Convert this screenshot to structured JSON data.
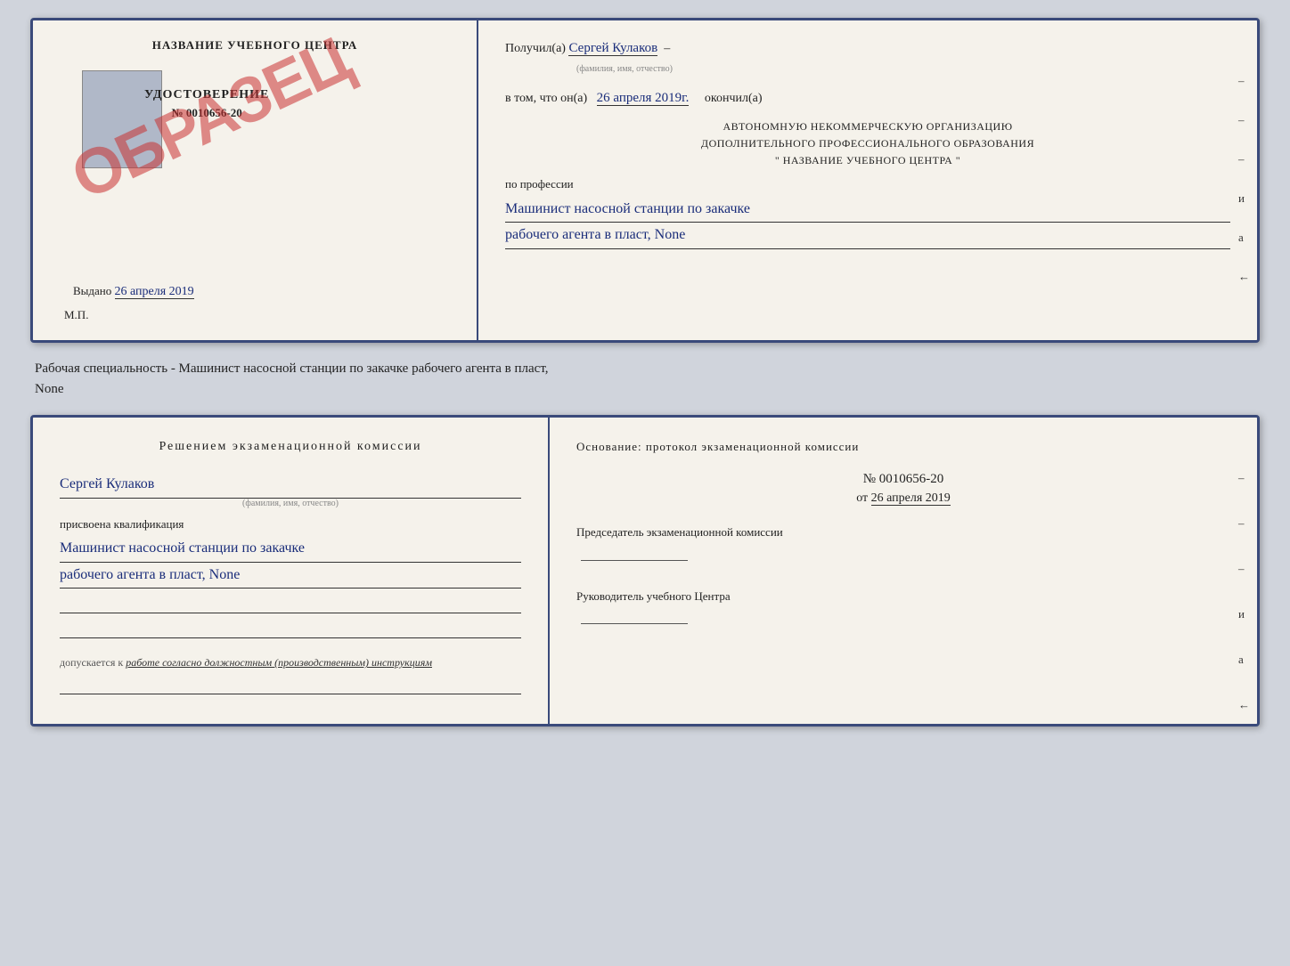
{
  "top_doc": {
    "left": {
      "title": "НАЗВАНИЕ УЧЕБНОГО ЦЕНТРА",
      "cert_label": "УДОСТОВЕРЕНИЕ",
      "cert_number": "№ 0010656-20",
      "stamp": "ОБРАЗЕЦ",
      "vydano_label": "Выдано",
      "vydano_date": "26 апреля 2019",
      "mp_label": "М.П."
    },
    "right": {
      "poluchil_label": "Получил(а)",
      "poluchil_name": "Сергей Кулаков",
      "fio_hint": "(фамилия, имя, отчество)",
      "vtom_label": "в том, что он(а)",
      "vtom_date": "26 апреля 2019г.",
      "okonchil_label": "окончил(а)",
      "center_line1": "АВТОНОМНУЮ НЕКОММЕРЧЕСКУЮ ОРГАНИЗАЦИЮ",
      "center_line2": "ДОПОЛНИТЕЛЬНОГО ПРОФЕССИОНАЛЬНОГО ОБРАЗОВАНИЯ",
      "center_line3": "\"  НАЗВАНИЕ УЧЕБНОГО ЦЕНТРА  \"",
      "po_professii": "по профессии",
      "profession_line1": "Машинист насосной станции по закачке",
      "profession_line2": "рабочего агента в пласт, None",
      "dashes": [
        "-",
        "-",
        "-",
        "и",
        "а",
        "←"
      ]
    }
  },
  "middle_text": {
    "line1": "Рабочая специальность - Машинист насосной станции по закачке рабочего агента в пласт,",
    "line2": "None"
  },
  "bottom_doc": {
    "left": {
      "title": "Решением  экзаменационной  комиссии",
      "name": "Сергей Кулаков",
      "fio_hint": "(фамилия, имя, отчество)",
      "prisvoena_label": "присвоена квалификация",
      "profession_line1": "Машинист насосной станции по закачке",
      "profession_line2": "рабочего агента в пласт, None",
      "dopuskaetsya_label": "допускается к",
      "dopuskaetsya_text": "работе согласно должностным (производственным) инструкциям"
    },
    "right": {
      "osnovanie_label": "Основание:  протокол  экзаменационной  комиссии",
      "protocol_number": "№  0010656-20",
      "date_label": "от",
      "date_value": "26 апреля 2019",
      "predsedatel_label": "Председатель экзаменационной комиссии",
      "rukovoditel_label": "Руководитель учебного Центра",
      "dashes": [
        "-",
        "-",
        "-",
        "-",
        "и",
        "а",
        "←",
        "-",
        "-",
        "-",
        "-"
      ]
    }
  }
}
